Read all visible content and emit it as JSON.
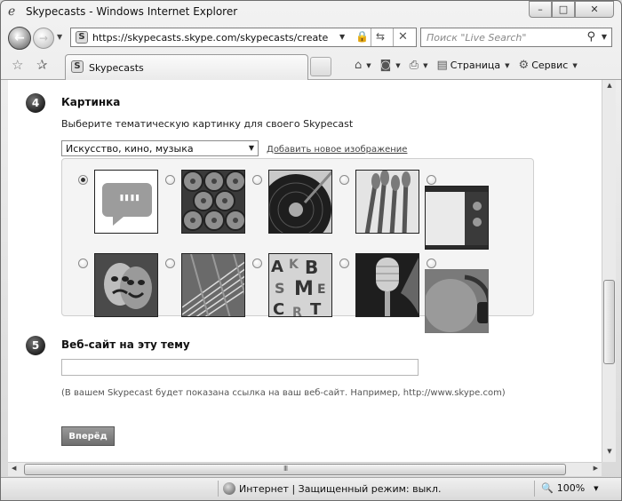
{
  "window": {
    "title": "Skypecasts - Windows Internet Explorer",
    "controls": {
      "minimize": "–",
      "maximize": "□",
      "close": "✕"
    }
  },
  "address_bar": {
    "url": "https://skypecasts.skype.com/skypecasts/create",
    "site_icon": "S"
  },
  "search": {
    "placeholder": "Поиск \"Live Search\""
  },
  "tab": {
    "label": "Skypecasts",
    "icon": "S"
  },
  "commands": {
    "page": "Страница",
    "tools": "Сервис"
  },
  "form": {
    "step4": {
      "number": "4",
      "title": "Картинка",
      "description": "Выберите тематическую картинку для своего Skypecast",
      "category_value": "Искусство, кино, музыка",
      "add_image_link": "Добавить новое изображение",
      "images": [
        {
          "name": "quote-bubble",
          "selected": true
        },
        {
          "name": "film-reels",
          "selected": false
        },
        {
          "name": "vinyl-record",
          "selected": false
        },
        {
          "name": "paint-brushes",
          "selected": false
        },
        {
          "name": "television",
          "selected": false
        },
        {
          "name": "theater-masks",
          "selected": false
        },
        {
          "name": "guitar-strings",
          "selected": false
        },
        {
          "name": "letters-collage",
          "selected": false
        },
        {
          "name": "microphone",
          "selected": false
        },
        {
          "name": "headphones",
          "selected": false
        }
      ]
    },
    "step5": {
      "number": "5",
      "title": "Веб-сайт на эту тему",
      "input_value": "",
      "hint": "(В вашем Skypecast будет показана ссылка на ваш веб-сайт. Например, http://www.skype.com)",
      "next_button": "Вперёд"
    }
  },
  "status_bar": {
    "text": "Интернет | Защищенный режим: выкл.",
    "zoom": "100%"
  },
  "scroll": {
    "grip": "III"
  }
}
